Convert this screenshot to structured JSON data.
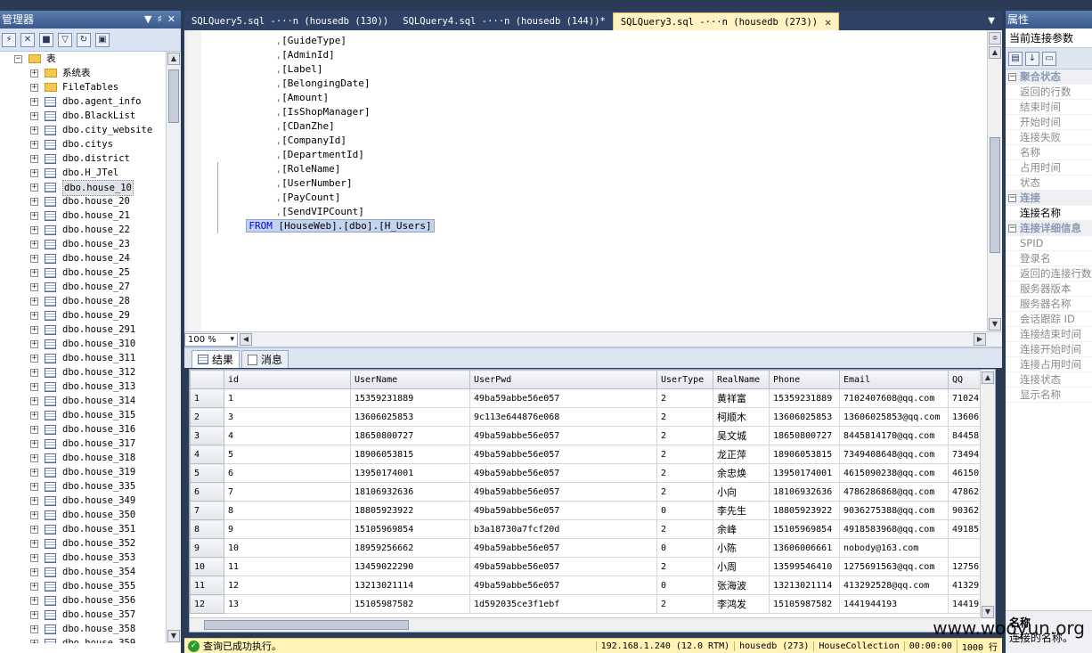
{
  "object_explorer": {
    "title": "管理器",
    "tree": [
      {
        "label": "表",
        "kind": "folder",
        "level": 0,
        "expanded": true
      },
      {
        "label": "系统表",
        "kind": "folder",
        "level": 1
      },
      {
        "label": "FileTables",
        "kind": "folder",
        "level": 1
      },
      {
        "label": "dbo.agent_info",
        "kind": "table",
        "level": 1
      },
      {
        "label": "dbo.BlackList",
        "kind": "table",
        "level": 1
      },
      {
        "label": "dbo.city_website",
        "kind": "table",
        "level": 1
      },
      {
        "label": "dbo.citys",
        "kind": "table",
        "level": 1
      },
      {
        "label": "dbo.district",
        "kind": "table",
        "level": 1
      },
      {
        "label": "dbo.H_JTel",
        "kind": "table",
        "level": 1
      },
      {
        "label": "dbo.house_10",
        "kind": "table",
        "level": 1,
        "selected": true
      },
      {
        "label": "dbo.house_20",
        "kind": "table",
        "level": 1
      },
      {
        "label": "dbo.house_21",
        "kind": "table",
        "level": 1
      },
      {
        "label": "dbo.house_22",
        "kind": "table",
        "level": 1
      },
      {
        "label": "dbo.house_23",
        "kind": "table",
        "level": 1
      },
      {
        "label": "dbo.house_24",
        "kind": "table",
        "level": 1
      },
      {
        "label": "dbo.house_25",
        "kind": "table",
        "level": 1
      },
      {
        "label": "dbo.house_27",
        "kind": "table",
        "level": 1
      },
      {
        "label": "dbo.house_28",
        "kind": "table",
        "level": 1
      },
      {
        "label": "dbo.house_29",
        "kind": "table",
        "level": 1
      },
      {
        "label": "dbo.house_291",
        "kind": "table",
        "level": 1
      },
      {
        "label": "dbo.house_310",
        "kind": "table",
        "level": 1
      },
      {
        "label": "dbo.house_311",
        "kind": "table",
        "level": 1
      },
      {
        "label": "dbo.house_312",
        "kind": "table",
        "level": 1
      },
      {
        "label": "dbo.house_313",
        "kind": "table",
        "level": 1
      },
      {
        "label": "dbo.house_314",
        "kind": "table",
        "level": 1
      },
      {
        "label": "dbo.house_315",
        "kind": "table",
        "level": 1
      },
      {
        "label": "dbo.house_316",
        "kind": "table",
        "level": 1
      },
      {
        "label": "dbo.house_317",
        "kind": "table",
        "level": 1
      },
      {
        "label": "dbo.house_318",
        "kind": "table",
        "level": 1
      },
      {
        "label": "dbo.house_319",
        "kind": "table",
        "level": 1
      },
      {
        "label": "dbo.house_335",
        "kind": "table",
        "level": 1
      },
      {
        "label": "dbo.house_349",
        "kind": "table",
        "level": 1
      },
      {
        "label": "dbo.house_350",
        "kind": "table",
        "level": 1
      },
      {
        "label": "dbo.house_351",
        "kind": "table",
        "level": 1
      },
      {
        "label": "dbo.house_352",
        "kind": "table",
        "level": 1
      },
      {
        "label": "dbo.house_353",
        "kind": "table",
        "level": 1
      },
      {
        "label": "dbo.house_354",
        "kind": "table",
        "level": 1
      },
      {
        "label": "dbo.house_355",
        "kind": "table",
        "level": 1
      },
      {
        "label": "dbo.house_356",
        "kind": "table",
        "level": 1
      },
      {
        "label": "dbo.house_357",
        "kind": "table",
        "level": 1
      },
      {
        "label": "dbo.house_358",
        "kind": "table",
        "level": 1
      },
      {
        "label": "dbo.house_359",
        "kind": "table",
        "level": 1
      }
    ]
  },
  "tabs": [
    {
      "label": "SQLQuery5.sql -···n (housedb (130))",
      "active": false
    },
    {
      "label": "SQLQuery4.sql -···n (housedb (144))*",
      "active": false
    },
    {
      "label": "SQLQuery3.sql -···n (housedb (273))",
      "active": true
    }
  ],
  "editor": {
    "lines": [
      "[GuideType]",
      "[AdminId]",
      "[Label]",
      "[BelongingDate]",
      "[Amount]",
      "[IsShopManager]",
      "[CDanZhe]",
      "[CompanyId]",
      "[DepartmentId]",
      "[RoleName]",
      "[UserNumber]",
      "[PayCount]",
      "[SendVIPCount]"
    ],
    "from_keyword": "FROM",
    "from_target": "[HouseWeb].[dbo].[H_Users]",
    "zoom": "100 %"
  },
  "results": {
    "tab_results": "结果",
    "tab_messages": "消息",
    "columns": [
      "id",
      "UserName",
      "UserPwd",
      "UserType",
      "RealName",
      "Phone",
      "Email",
      "QQ"
    ],
    "rows": [
      [
        "1",
        "1",
        "15359231889",
        "49ba59abbe56e057",
        "2",
        "黄祥富",
        "15359231889",
        "7102407608@qq.com",
        "71024"
      ],
      [
        "2",
        "3",
        "13606025853",
        "9c113e644876e068",
        "2",
        "柯顺木",
        "13606025853",
        "13606025853@qq.com",
        "13606"
      ],
      [
        "3",
        "4",
        "18650800727",
        "49ba59abbe56e057",
        "2",
        "吴文城",
        "18650800727",
        "8445814170@qq.com",
        "84458"
      ],
      [
        "4",
        "5",
        "18906053815",
        "49ba59abbe56e057",
        "2",
        "龙正萍",
        "18906053815",
        "7349408648@qq.com",
        "73494"
      ],
      [
        "5",
        "6",
        "13950174001",
        "49ba59abbe56e057",
        "2",
        "余忠焕",
        "13950174001",
        "4615090238@qq.com",
        "46150"
      ],
      [
        "6",
        "7",
        "18106932636",
        "49ba59abbe56e057",
        "2",
        "小向",
        "18106932636",
        "4786286868@qq.com",
        "47862"
      ],
      [
        "7",
        "8",
        "18805923922",
        "49ba59abbe56e057",
        "0",
        "李先生",
        "18805923922",
        "9036275388@qq.com",
        "90362"
      ],
      [
        "8",
        "9",
        "15105969854",
        "b3a18730a7fcf20d",
        "2",
        "余峰",
        "15105969854",
        "4918583968@qq.com",
        "49185"
      ],
      [
        "9",
        "10",
        "18959256662",
        "49ba59abbe56e057",
        "0",
        "小陈",
        "13606006661",
        "nobody@163.com",
        ""
      ],
      [
        "10",
        "11",
        "13459022290",
        "49ba59abbe56e057",
        "2",
        "小周",
        "13599546410",
        "1275691563@qq.com",
        "12756"
      ],
      [
        "11",
        "12",
        "13213021114",
        "49ba59abbe56e057",
        "0",
        "张海波",
        "13213021114",
        "413292528@qq.com",
        "41329"
      ],
      [
        "12",
        "13",
        "15105987582",
        "1d592035ce3f1ebf",
        "2",
        "李鸿发",
        "15105987582",
        "1441944193",
        "14419"
      ]
    ]
  },
  "status_bar": {
    "message": "查询已成功执行。",
    "server": "192.168.1.240 (12.0 RTM)",
    "db_session": "housedb (273)",
    "db": "HouseCollection",
    "time": "00:00:00",
    "rows": "1000 行"
  },
  "properties": {
    "title": "属性",
    "combo": "当前连接参数",
    "items": [
      {
        "type": "cat",
        "label": "聚合状态"
      },
      {
        "type": "item",
        "label": "返回的行数"
      },
      {
        "type": "item",
        "label": "结束时间"
      },
      {
        "type": "item",
        "label": "开始时间"
      },
      {
        "type": "item",
        "label": "连接失败"
      },
      {
        "type": "item",
        "label": "名称"
      },
      {
        "type": "item",
        "label": "占用时间"
      },
      {
        "type": "item",
        "label": "状态"
      },
      {
        "type": "cat",
        "label": "连接"
      },
      {
        "type": "item",
        "label": "连接名称",
        "dark": true
      },
      {
        "type": "cat",
        "label": "连接详细信息"
      },
      {
        "type": "item",
        "label": "SPID"
      },
      {
        "type": "item",
        "label": "登录名"
      },
      {
        "type": "item",
        "label": "返回的连接行数"
      },
      {
        "type": "item",
        "label": "服务器版本"
      },
      {
        "type": "item",
        "label": "服务器名称"
      },
      {
        "type": "item",
        "label": "会话跟踪 ID"
      },
      {
        "type": "item",
        "label": "连接结束时间"
      },
      {
        "type": "item",
        "label": "连接开始时间"
      },
      {
        "type": "item",
        "label": "连接占用时间"
      },
      {
        "type": "item",
        "label": "连接状态"
      },
      {
        "type": "item",
        "label": "显示名称"
      }
    ],
    "desc_title": "名称",
    "desc_text": "连接的名称。"
  },
  "watermark": "www.wooyun.org"
}
